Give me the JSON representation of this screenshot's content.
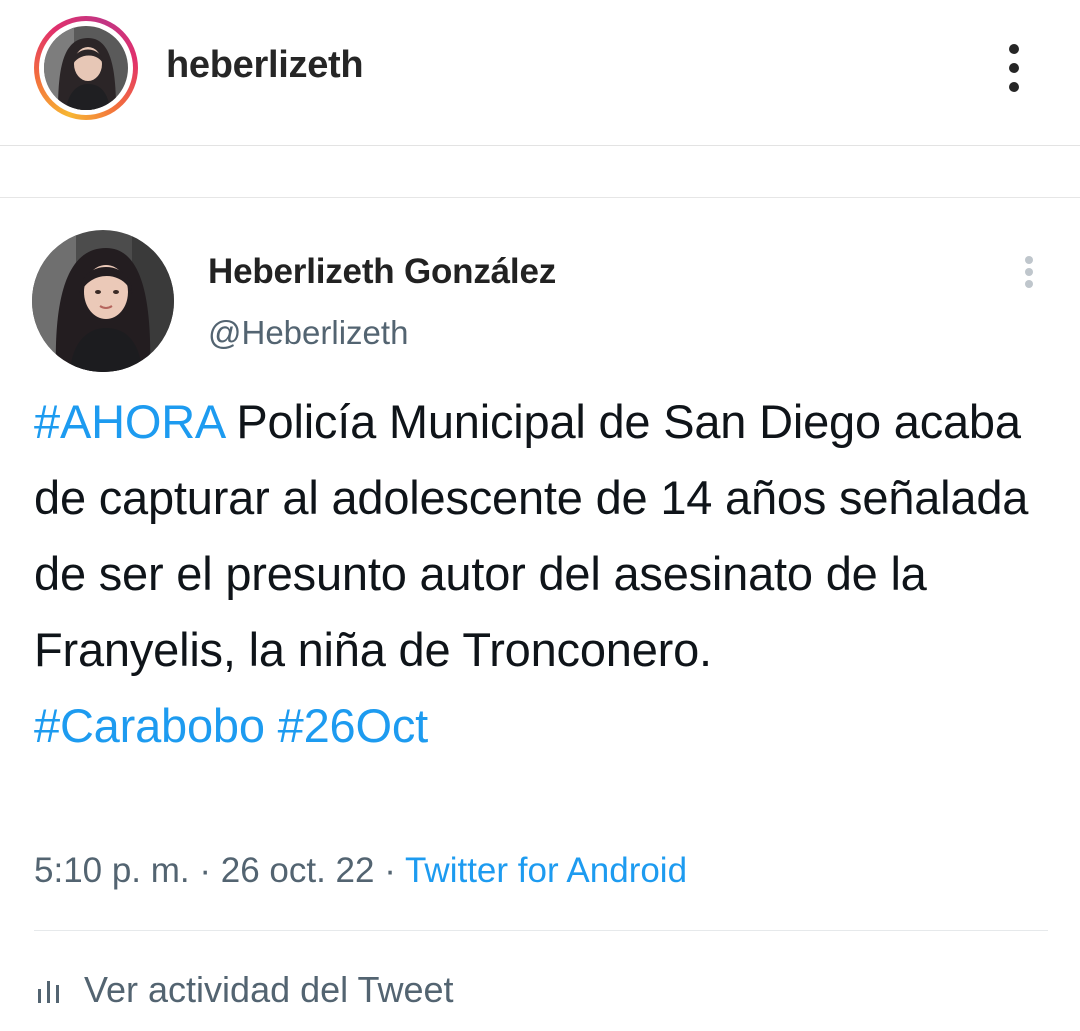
{
  "instagram": {
    "username": "heberlizeth",
    "more_icon": "vertical-ellipsis-icon"
  },
  "tweet": {
    "display_name": "Heberlizeth González",
    "handle": "@Heberlizeth",
    "more_icon": "vertical-ellipsis-icon",
    "body": {
      "hashtag_lead": "#AHORA",
      "text": "Policía Municipal de San Diego acaba de capturar al adolescente de 14 años señalada de ser el presunto autor del asesinato de la Franyelis, la niña de Tronconero.",
      "hashtag_1": "#Carabobo",
      "hashtag_2": "#26Oct"
    },
    "meta": {
      "time": "5:10 p. m.",
      "separator": "·",
      "date": "26 oct. 22",
      "source": "Twitter for Android"
    },
    "activity": {
      "icon": "bar-chart-icon",
      "label": "Ver actividad del Tweet"
    }
  },
  "colors": {
    "hashtag": "#1d9bf0",
    "muted": "#536471",
    "text": "#0f1419"
  }
}
